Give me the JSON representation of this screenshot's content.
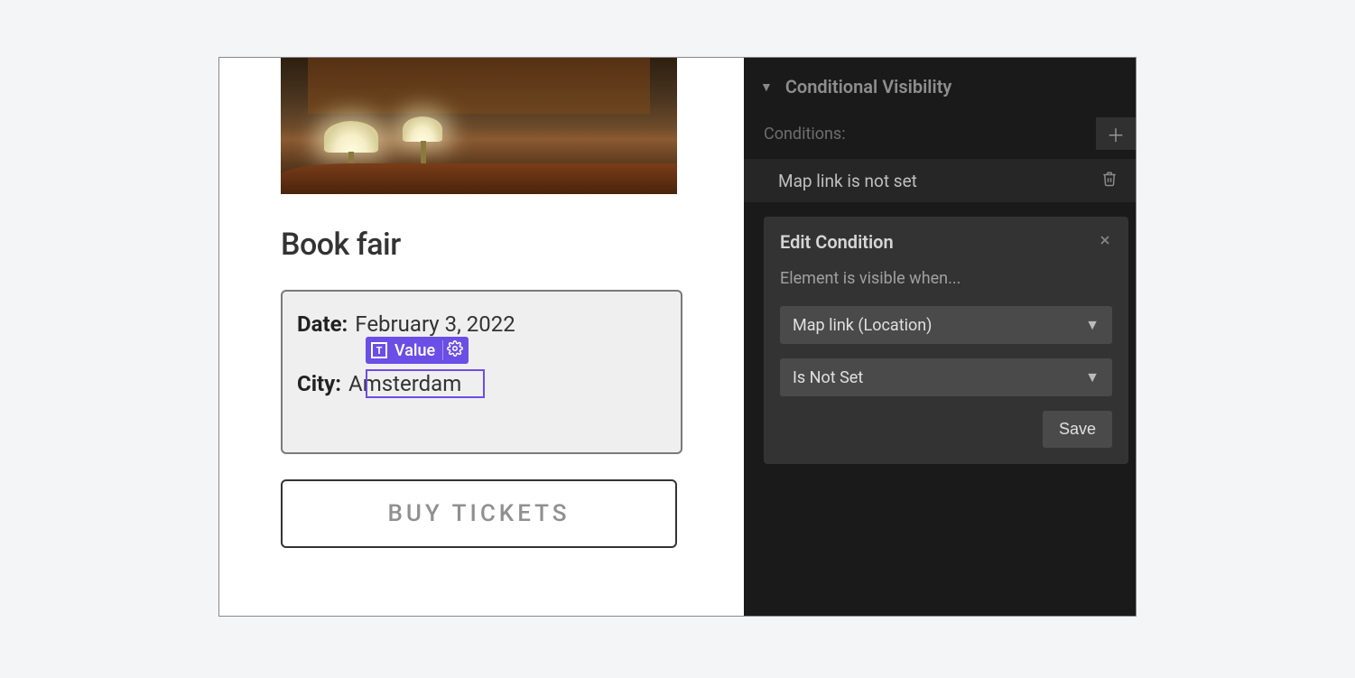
{
  "canvas": {
    "title": "Book fair",
    "date_label": "Date:",
    "date_value": "February 3, 2022",
    "city_label": "City:",
    "city_value": "Amsterdam",
    "value_badge_label": "Value",
    "buy_button": "BUY TICKETS"
  },
  "panel": {
    "section_title": "Conditional Visibility",
    "conditions_label": "Conditions:",
    "condition_items": [
      "Map link is not set"
    ],
    "edit": {
      "title": "Edit Condition",
      "desc": "Element is visible when...",
      "select_element": "Map link (Location)",
      "select_operator": "Is Not Set",
      "save": "Save"
    }
  }
}
